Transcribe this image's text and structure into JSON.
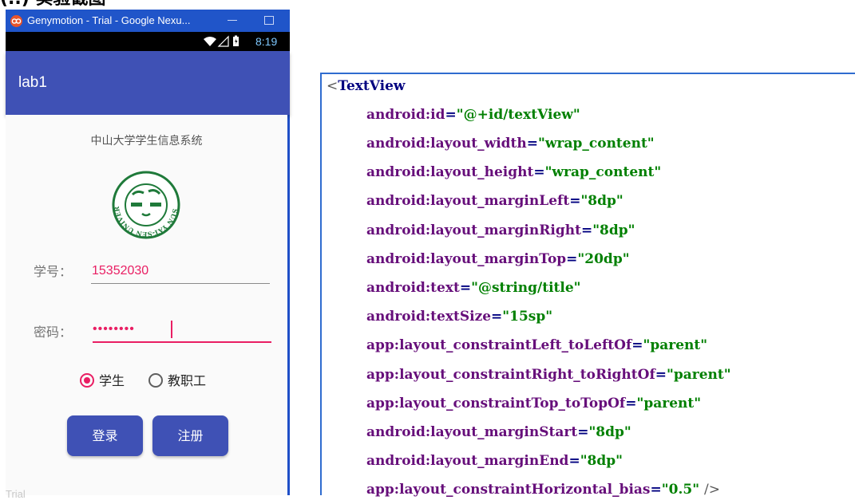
{
  "page_heading": "(..) 实验截图",
  "window": {
    "title": "Genymotion - Trial - Google Nexu...",
    "status_time": "8:19"
  },
  "app": {
    "toolbar_title": "lab1",
    "header": "中山大学学生信息系统",
    "logo_text": "SUN YAT-SEN UNIVERSITY",
    "student_id_label": "学号：",
    "student_id_value": "15352030",
    "password_label": "密码：",
    "password_mask": "••••••••",
    "radio_student": "学生",
    "radio_staff": "教职工",
    "login_button": "登录",
    "register_button": "注册",
    "watermark": "Trial"
  },
  "code": {
    "tag": "TextView",
    "attributes": [
      {
        "name": "android:id",
        "value": "\"@+id/textView\""
      },
      {
        "name": "android:layout_width",
        "value": "\"wrap_content\""
      },
      {
        "name": "android:layout_height",
        "value": "\"wrap_content\""
      },
      {
        "name": "android:layout_marginLeft",
        "value": "\"8dp\""
      },
      {
        "name": "android:layout_marginRight",
        "value": "\"8dp\""
      },
      {
        "name": "android:layout_marginTop",
        "value": "\"20dp\""
      },
      {
        "name": "android:text",
        "value": "\"@string/title\""
      },
      {
        "name": "android:textSize",
        "value": "\"15sp\""
      },
      {
        "name": "app:layout_constraintLeft_toLeftOf",
        "value": "\"parent\""
      },
      {
        "name": "app:layout_constraintRight_toRightOf",
        "value": "\"parent\""
      },
      {
        "name": "app:layout_constraintTop_toTopOf",
        "value": "\"parent\""
      },
      {
        "name": "android:layout_marginStart",
        "value": "\"8dp\""
      },
      {
        "name": "android:layout_marginEnd",
        "value": "\"8dp\""
      },
      {
        "name": "app:layout_constraintHorizontal_bias",
        "value": "\"0.5\"",
        "closing": "/>"
      }
    ]
  },
  "colors": {
    "primary": "#3f51b5",
    "accent": "#e91e63",
    "window_frame": "#2055c9"
  }
}
